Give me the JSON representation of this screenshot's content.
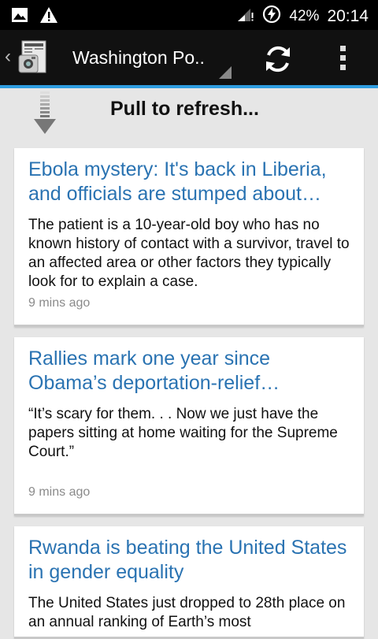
{
  "status_bar": {
    "battery": "42%",
    "time": "20:14"
  },
  "action_bar": {
    "title": "Washington Po..",
    "accent_color": "#2f9de0"
  },
  "pull_to_refresh": {
    "label": "Pull to refresh..."
  },
  "articles": [
    {
      "title": "Ebola mystery: It's back in Liberia, and officials are stumped about…",
      "summary": "The patient is a 10-year-old boy who has no known history of contact with a survivor, travel to an affected area or other factors they typically look for to explain a case.",
      "time": "9 mins ago"
    },
    {
      "title": "Rallies mark one year since Obama’s deportation-relief…",
      "summary": "“It’s scary for them. . . Now we just have the papers sitting at home waiting for the Supreme Court.”",
      "time": "9 mins ago"
    },
    {
      "title": "Rwanda is beating the United States in gender equality",
      "summary": "The United States just dropped to 28th place on an annual ranking of Earth’s most",
      "time": ""
    }
  ]
}
